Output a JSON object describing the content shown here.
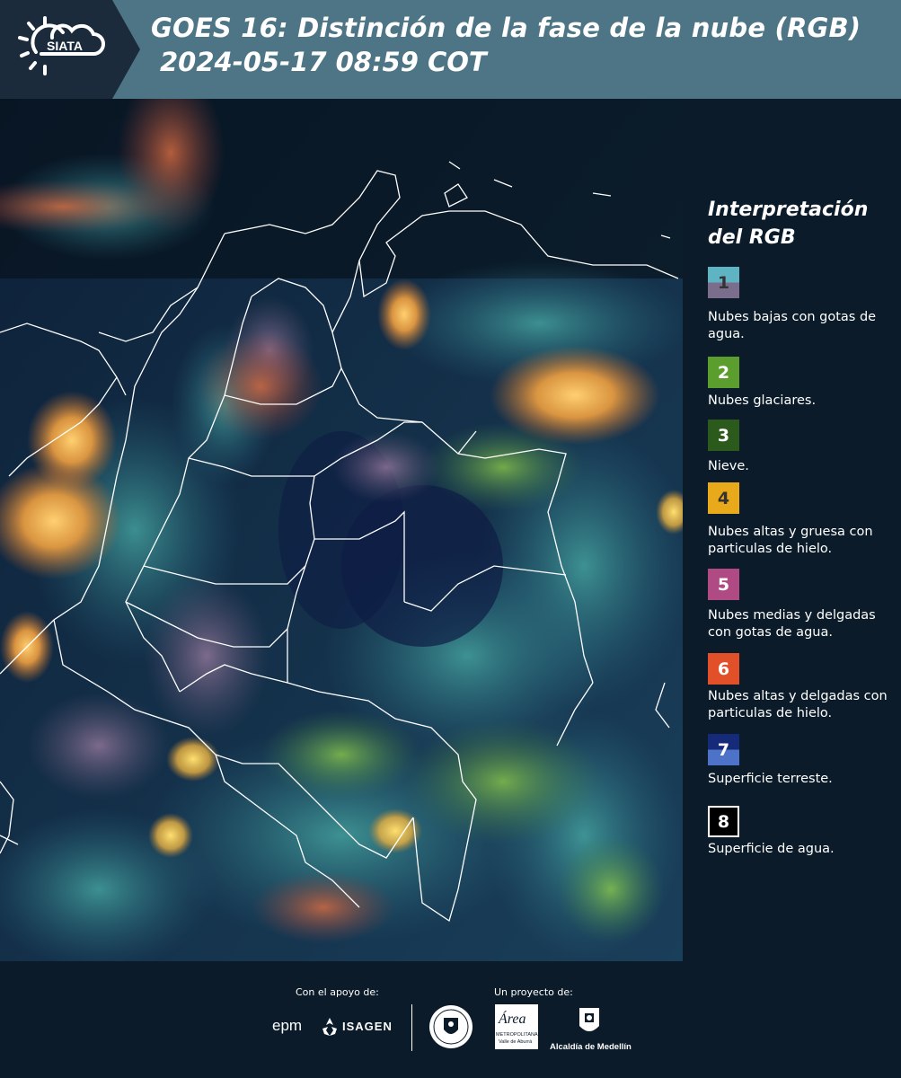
{
  "header": {
    "logo_text": "SIATA",
    "title_line1": "GOES 16: Distinción de la fase de la nube (RGB)",
    "title_line2": "2024-05-17 08:59 COT"
  },
  "legend": {
    "title": "Interpretación del RGB",
    "items": [
      {
        "number": "1",
        "label": "Nubes bajas con gotas de agua.",
        "color_top": "#5fb4c4",
        "color_bottom": "#7a6e8c",
        "text_color": "#333333"
      },
      {
        "number": "2",
        "label": "Nubes glaciares.",
        "color_top": "#5b9e2e",
        "color_bottom": "#5b9e2e",
        "text_color": "#ffffff"
      },
      {
        "number": "3",
        "label": "Nieve.",
        "color_top": "#2c5a1c",
        "color_bottom": "#2c5a1c",
        "text_color": "#ffffff"
      },
      {
        "number": "4",
        "label": "Nubes altas y gruesa con particulas de hielo.",
        "color_top": "#e8a91a",
        "color_bottom": "#e8a91a",
        "text_color": "#333333"
      },
      {
        "number": "5",
        "label": "Nubes medias y delgadas con gotas de agua.",
        "color_top": "#b04a85",
        "color_bottom": "#b04a85",
        "text_color": "#ffffff"
      },
      {
        "number": "6",
        "label": "Nubes altas y delgadas con particulas de hielo.",
        "color_top": "#e2502a",
        "color_bottom": "#e2502a",
        "text_color": "#ffffff"
      },
      {
        "number": "7",
        "label": "Superficie terreste.",
        "color_top": "#152a78",
        "color_bottom": "#4c73c7",
        "text_color": "#ffffff"
      },
      {
        "number": "8",
        "label": "Superficie de agua.",
        "color_top": "#000000",
        "color_bottom": "#000000",
        "text_color": "#ffffff"
      }
    ]
  },
  "footer": {
    "support_caption": "Con el apoyo de:",
    "project_caption": "Un proyecto de:",
    "sponsor1": "epm",
    "sponsor2": "ISAGEN",
    "partner_area": "Área",
    "partner_area_sub": "METROPOLITANA",
    "partner_area_sub2": "Valle de Aburrá",
    "partner_medellin": "Alcaldía de Medellín"
  },
  "colors": {
    "header_bg": "#4e7585",
    "logo_tab_bg": "#1b2b3b",
    "panel_bg": "#0b1b29",
    "map_ocean": "#0f1c3c",
    "boundary": "#ffffff"
  }
}
